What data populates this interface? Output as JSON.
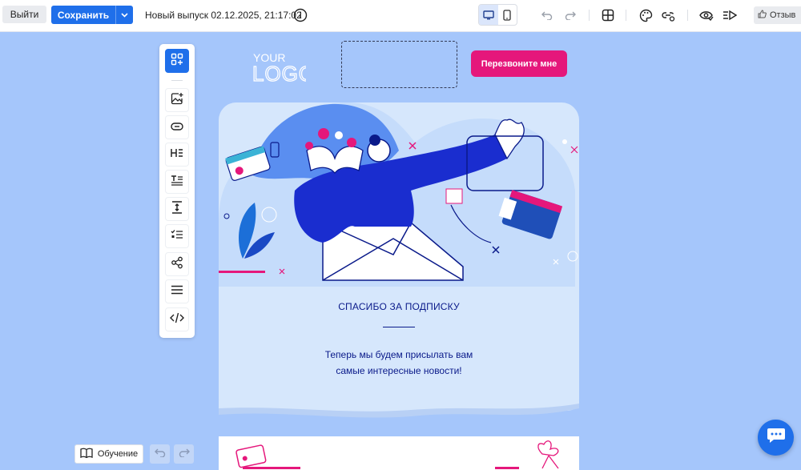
{
  "toolbar": {
    "exit_label": "Выйти",
    "save_label": "Сохранить",
    "issue_title": "Новый выпуск 02.12.2025, 21:17:02",
    "feedback_label": "Отзыв",
    "icons": [
      "info-icon",
      "desktop-icon",
      "mobile-icon",
      "undo-icon",
      "redo-icon",
      "grid-icon",
      "palette-icon",
      "link-settings-icon",
      "preview-icon",
      "send-test-icon",
      "thumbs-up-icon"
    ]
  },
  "blocks_panel": {
    "items": [
      "add-block",
      "image",
      "button",
      "heading",
      "text",
      "spacer",
      "list",
      "social",
      "divider",
      "html"
    ]
  },
  "email": {
    "logo_line1": "YOUR",
    "logo_line2": "LOGO",
    "callback_button": "Перезвоните мне",
    "thanks_title": "СПАСИБО ЗА ПОДПИСКУ",
    "thanks_text_line1": "Теперь мы будем присылать вам",
    "thanks_text_line2": "самые интересные новости!"
  },
  "bottom": {
    "tutorial_label": "Обучение"
  },
  "colors": {
    "accent": "#1f6fea",
    "canvas_bg": "#a5c6fb",
    "card_bg": "#d6e7fc",
    "cta_pink": "#e5177b",
    "text_navy": "#0a1a8a"
  }
}
